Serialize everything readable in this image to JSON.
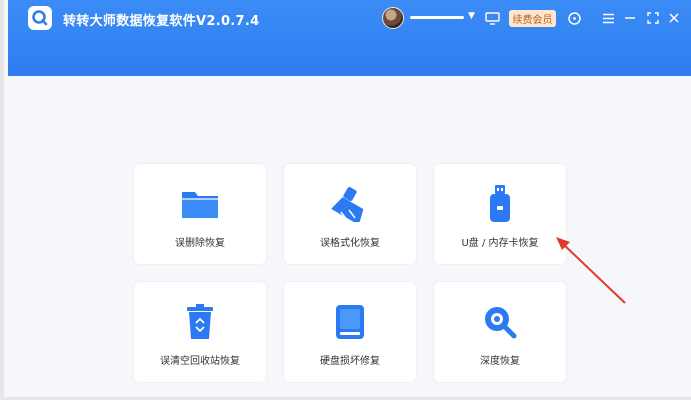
{
  "titlebar": {
    "app_title": "转转大师数据恢复软件V2.0.7.4",
    "logo_icon": "search-q-logo-icon",
    "renew_label": "续费会员",
    "icons": [
      "monitor-icon",
      "support-icon",
      "menu-icon",
      "minimize-icon",
      "fullscreen-icon",
      "close-icon"
    ]
  },
  "cards": [
    {
      "label": "误删除恢复",
      "icon": "folder-icon"
    },
    {
      "label": "误格式化恢复",
      "icon": "broom-icon"
    },
    {
      "label": "U盘 / 内存卡恢复",
      "icon": "usb-drive-icon"
    },
    {
      "label": "误清空回收站恢复",
      "icon": "recycle-bin-icon"
    },
    {
      "label": "硬盘损坏修复",
      "icon": "hard-disk-icon"
    },
    {
      "label": "深度恢复",
      "icon": "magnifier-icon"
    }
  ],
  "colors": {
    "primary": "#2f7df0",
    "renew_bg": "#ffe6cf",
    "annotation_arrow": "#e03a2f"
  }
}
